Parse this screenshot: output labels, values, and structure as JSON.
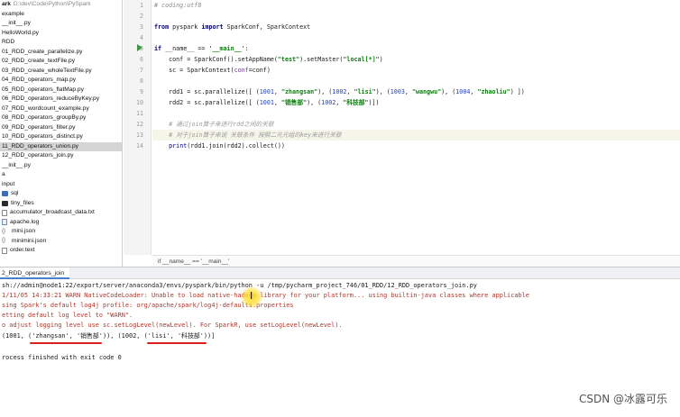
{
  "project_tree": {
    "root": {
      "name": "ark",
      "path": "D:\\dev\\Code\\Python\\PySpark"
    },
    "items": [
      {
        "label": "example",
        "icon": "folder"
      },
      {
        "label": "__init__.py",
        "icon": "python-file"
      },
      {
        "label": "HelloWorld.py",
        "icon": "python-file"
      },
      {
        "label": "RDD",
        "icon": "folder"
      },
      {
        "label": "01_RDD_create_parallelize.py",
        "icon": "python-file"
      },
      {
        "label": "02_RDD_create_textFile.py",
        "icon": "python-file"
      },
      {
        "label": "03_RDD_create_wholeTextFile.py",
        "icon": "python-file"
      },
      {
        "label": "04_RDD_operators_map.py",
        "icon": "python-file"
      },
      {
        "label": "05_RDD_operators_flatMap.py",
        "icon": "python-file"
      },
      {
        "label": "06_RDD_operators_reduceByKey.py",
        "icon": "python-file"
      },
      {
        "label": "07_RDD_wordcount_example.py",
        "icon": "python-file"
      },
      {
        "label": "08_RDD_operators_groupBy.py",
        "icon": "python-file"
      },
      {
        "label": "09_RDD_operators_filter.py",
        "icon": "python-file"
      },
      {
        "label": "10_RDD_operators_distinct.py",
        "icon": "python-file"
      },
      {
        "label": "11_RDD_operators_union.py",
        "icon": "python-file",
        "selected": true
      },
      {
        "label": "12_RDD_operators_join.py",
        "icon": "python-file"
      },
      {
        "label": "__init__.py",
        "icon": "python-file"
      },
      {
        "label": "a",
        "icon": "folder"
      },
      {
        "label": "input",
        "icon": "folder"
      },
      {
        "label": "sql",
        "icon": "folder-icon"
      },
      {
        "label": "tiny_files",
        "icon": "folder-dark"
      },
      {
        "label": "accumulator_broadcast_data.txt",
        "icon": "text-file"
      },
      {
        "label": "apache.log",
        "icon": "log-file"
      },
      {
        "label": "mini.json",
        "icon": "json-file"
      },
      {
        "label": "minimini.json",
        "icon": "json-file"
      },
      {
        "label": "order.text",
        "icon": "text-file"
      }
    ]
  },
  "editor": {
    "line_numbers": [
      "1",
      "2",
      "3",
      "4",
      "5",
      "6",
      "7",
      "8",
      "9",
      "10",
      "11",
      "12",
      "13",
      "14"
    ],
    "current_line": "13",
    "code": {
      "l1": "# coding:utf8",
      "l3_kw1": "from",
      "l3_mod": " pyspark ",
      "l3_kw2": "import",
      "l3_rest": " SparkConf, SparkContext",
      "l5_kw": "if",
      "l5_a": " __name__ == ",
      "l5_str": "'__main__'",
      "l5_b": ":",
      "l6_a": "    conf = SparkConf().setAppName(",
      "l6_s1": "\"test\"",
      "l6_b": ").setMaster(",
      "l6_s2": "\"local[*]\"",
      "l6_c": ")",
      "l7_a": "    sc = SparkContext(",
      "l7_p": "conf",
      "l7_b": "=conf)",
      "l9_a": "    rdd1 = sc.parallelize([ (",
      "l9_n1": "1001",
      "l9_s1": "\"zhangsan\"",
      "l9_n2": "1002",
      "l9_s2": "\"lisi\"",
      "l9_n3": "1003",
      "l9_s3": "\"wangwu\"",
      "l9_n4": "1004",
      "l9_s4": "\"zhaoliu\"",
      "l10_a": "    rdd2 = sc.parallelize([ (",
      "l10_n1": "1001",
      "l10_s1": "\"销售部\"",
      "l10_n2": "1002",
      "l10_s2": "\"科技部\"",
      "l12": "    # 通过join算子来进行rdd之间的关联",
      "l13": "    # 对于join算子来说 关联条件 按照二元元组的key来进行关联",
      "l14_fn": "print",
      "l14_rest": "(rdd1.join(rdd2).collect())"
    }
  },
  "breadcrumb": "if __name__ == '__main__'",
  "run_panel": {
    "tab_label": "2_RDD_operators_join",
    "console_lines": [
      "sh://admin@node1:22/export/server/anaconda3/envs/pyspark/bin/python -u /tmp/pycharm_project_746/01_RDD/12_RDD_operators_join.py",
      "1/11/05 14:33:21 WARN NativeCodeLoader: Unable to load native-hadoop library for your platform... using builtin-java classes where applicable",
      "sing Spark's default log4j profile: org/apache/spark/log4j-defaults.properties",
      "etting default log level to \"WARN\".",
      "o adjust logging level use sc.setLogLevel(newLevel). For SparkR, use setLogLevel(newLevel).",
      "(1001, ('zhangsan', '销售部')), (1002, ('lisi', '科技部'))]",
      "",
      "rocess finished with exit code 0"
    ],
    "highlight_color": "#d81e1e"
  },
  "watermark": "CSDN @冰露可乐"
}
